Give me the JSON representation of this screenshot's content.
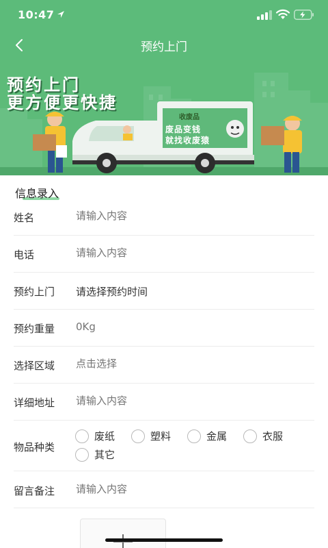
{
  "status_bar": {
    "time": "10:47"
  },
  "nav": {
    "title": "预约上门"
  },
  "banner": {
    "line1": "预约上门",
    "line2": "更方便更快捷",
    "truck_brand": "收废品",
    "truck_line1": "废品变钱",
    "truck_line2": "就找收废猿"
  },
  "form": {
    "section_title": "信息录入",
    "fields": [
      {
        "label": "姓名",
        "value": "",
        "placeholder": "请输入内容"
      },
      {
        "label": "电话",
        "value": "",
        "placeholder": "请输入内容"
      },
      {
        "label": "预约上门",
        "value": "请选择预约时间"
      },
      {
        "label": "预约重量",
        "value": "",
        "placeholder": "0Kg"
      },
      {
        "label": "选择区域",
        "value": "",
        "placeholder": "点击选择"
      },
      {
        "label": "详细地址",
        "value": "",
        "placeholder": "请输入内容"
      },
      {
        "label": "物品种类"
      },
      {
        "label": "留言备注",
        "value": "",
        "placeholder": "请输入内容"
      }
    ],
    "categories": [
      "废纸",
      "塑料",
      "金属",
      "衣服",
      "其它"
    ]
  },
  "colors": {
    "header_green": "#5cbb7a",
    "banner_green": "#5dbb79",
    "accent_underline": "#8fd8a4",
    "placeholder_gray": "#b5b5b5",
    "divider": "#ececec"
  }
}
